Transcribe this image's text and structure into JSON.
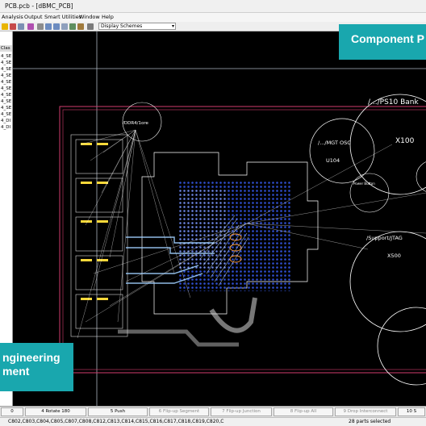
{
  "window": {
    "title": "PCB.pcb - [dBMC_PCB]"
  },
  "menu": [
    "Analysis",
    "Output",
    "Smart Utilities",
    "Window",
    "Help"
  ],
  "toolbar": {
    "display_scheme": "Display Schemes"
  },
  "side_panel": {
    "rows": [
      "Clas",
      "4_SE",
      "4_SE",
      "4_SE",
      "4_SE",
      "4_SE",
      "4_SE",
      "4_SE",
      "4_SE",
      "4_SE",
      "4_SE",
      "4_DI",
      "4_DI"
    ]
  },
  "canvas_labels": {
    "ps10": "/.../PS10 Bank",
    "x100": "X100",
    "mgt": "/.../MGT OSC",
    "u104": "U104",
    "power_button": "Power Button",
    "jtag": "/Support/JTAG",
    "x500": "X500",
    "ddr4": "/DDR4/1ore"
  },
  "banners": {
    "right": "Component P",
    "left_line1": "ngineering",
    "left_line2": "ment"
  },
  "command_bar": [
    {
      "label": "0",
      "enabled": true
    },
    {
      "label": "4 Rotate 180",
      "enabled": true
    },
    {
      "label": "5 Push",
      "enabled": true
    },
    {
      "label": "6 Flip-up Segment",
      "enabled": false
    },
    {
      "label": "7 Flip-up Junction",
      "enabled": false
    },
    {
      "label": "8 Flip-up All",
      "enabled": false
    },
    {
      "label": "9 Drop Interconnect",
      "enabled": false
    },
    {
      "label": "10 S",
      "enabled": true
    }
  ],
  "status": {
    "left": "C802,C803,C804,C805,C807,C808,C812,C813,C814,C815,C816,C817,C818,C819,C820,C",
    "right": "28 parts selected"
  },
  "colors": {
    "accent": "#19a7ae",
    "board_outline": "#d23c6e",
    "grid_fill": "#2f4fd0"
  }
}
